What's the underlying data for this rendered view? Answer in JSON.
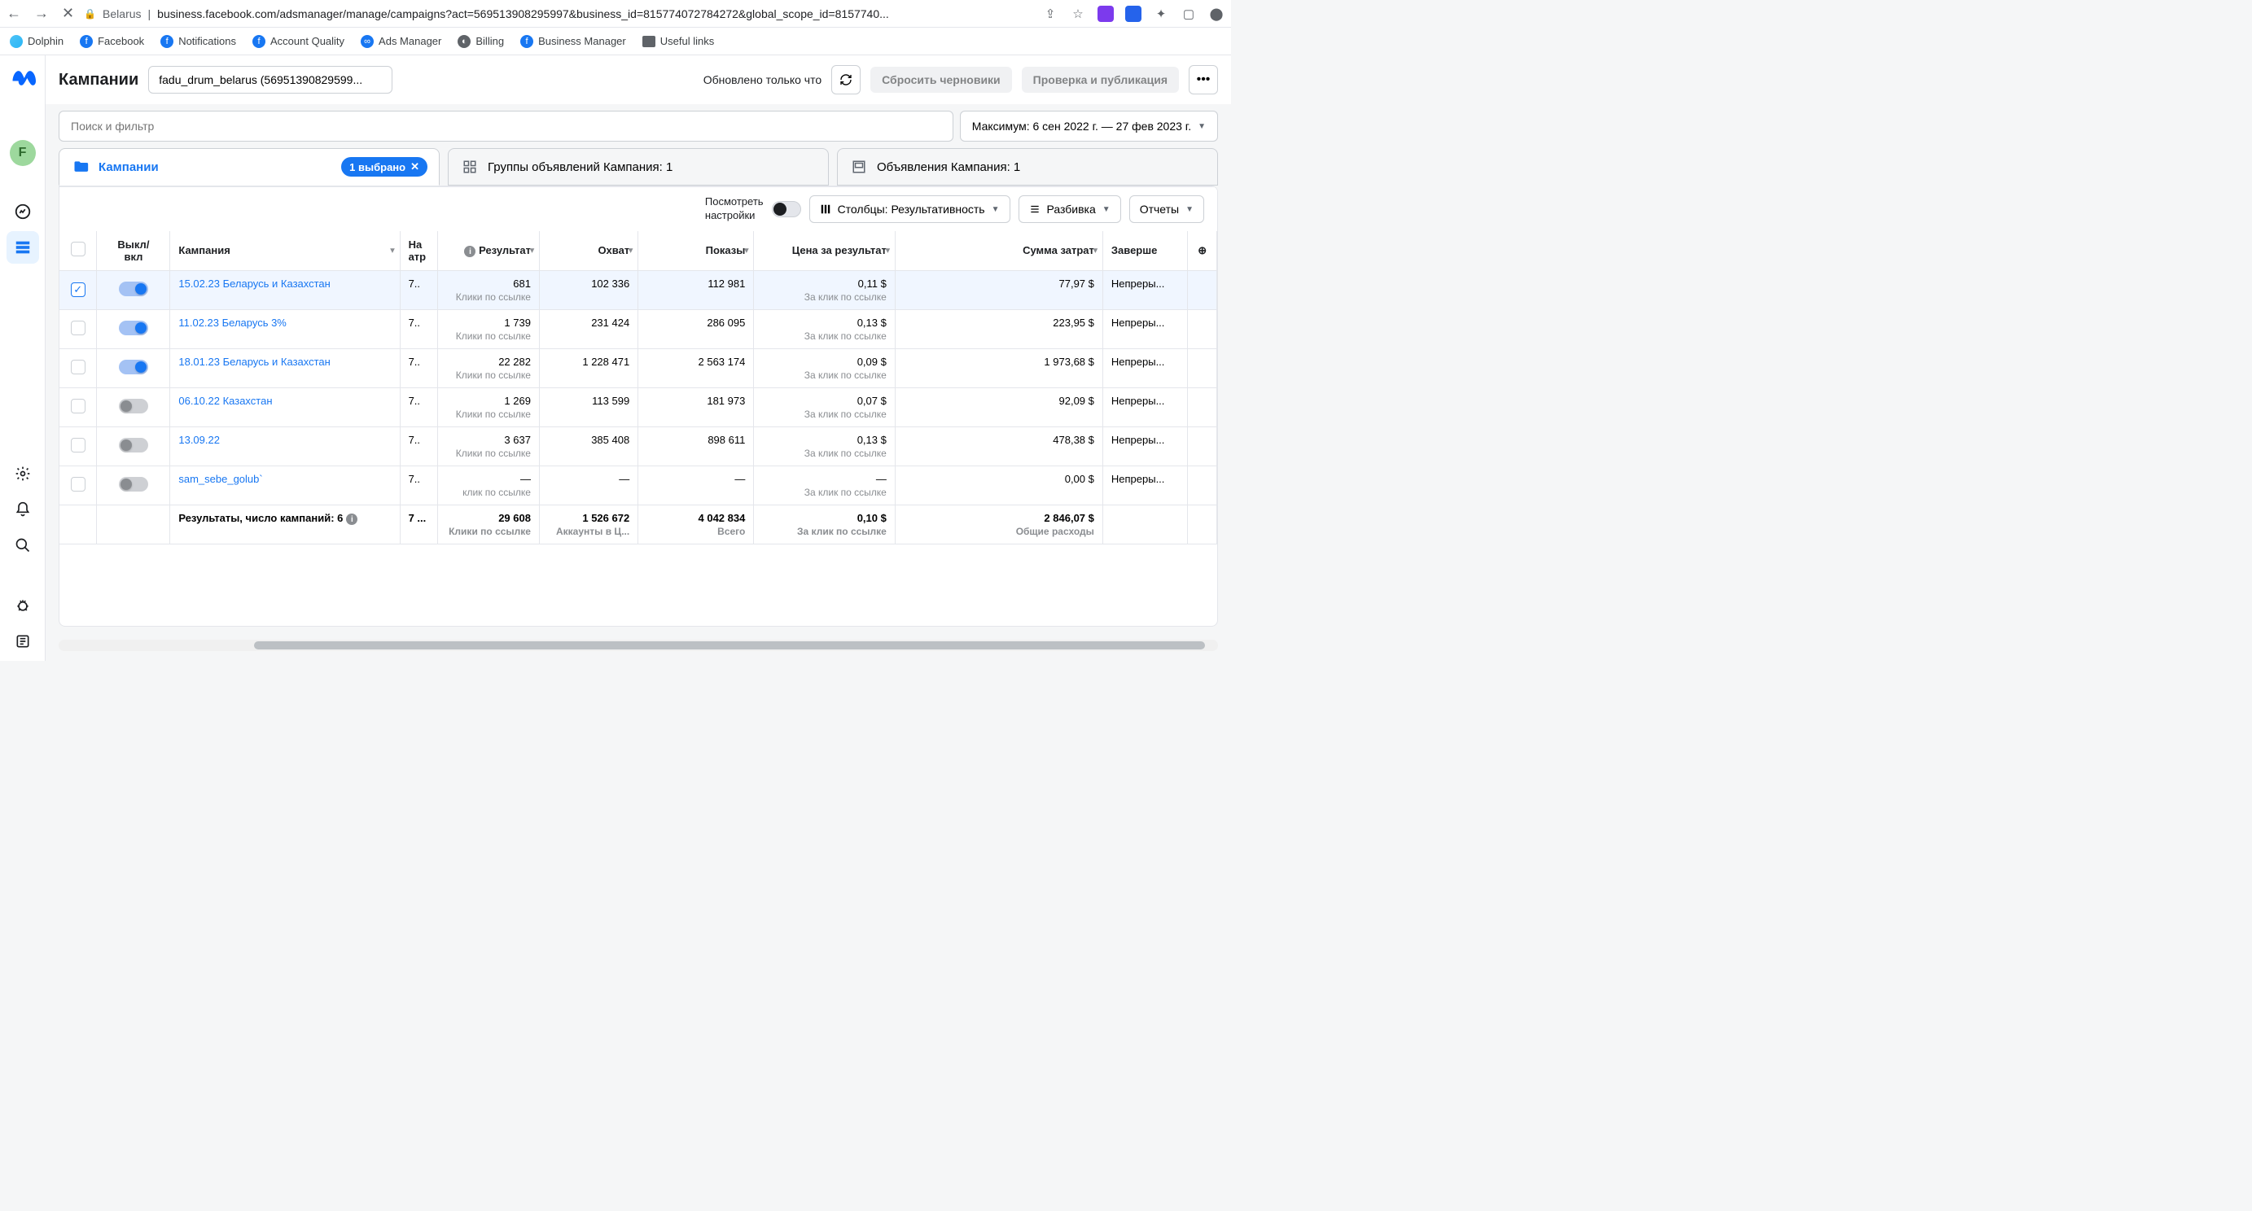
{
  "browser": {
    "country": "Belarus",
    "url": "business.facebook.com/adsmanager/manage/campaigns?act=569513908295997&business_id=815774072784272&global_scope_id=8157740..."
  },
  "bookmarks": [
    "Dolphin",
    "Facebook",
    "Notifications",
    "Account Quality",
    "Ads Manager",
    "Billing",
    "Business Manager",
    "Useful links"
  ],
  "header": {
    "title": "Кампании",
    "account": "fadu_drum_belarus (56951390829599...",
    "updated": "Обновлено только что",
    "reset": "Сбросить черновики",
    "review": "Проверка и публикация"
  },
  "search": {
    "placeholder": "Поиск и фильтр"
  },
  "date": "Максимум: 6 сен 2022 г. — 27 фев 2023 г.",
  "tabs": {
    "campaigns": "Кампании",
    "selected": "1 выбрано",
    "adsets": "Группы объявлений Кампания: 1",
    "ads": "Объявления Кампания: 1"
  },
  "toolbar": {
    "view_settings_l1": "Посмотреть",
    "view_settings_l2": "настройки",
    "columns": "Столбцы: Результативность",
    "breakdown": "Разбивка",
    "reports": "Отчеты"
  },
  "columns": {
    "onoff_l1": "Выкл/",
    "onoff_l2": "вкл",
    "campaign": "Кампания",
    "attr_l1": "На",
    "attr_l2": "атр",
    "result": "Результат",
    "reach": "Охват",
    "impressions": "Показы",
    "cpr": "Цена за результат",
    "spend": "Сумма затрат",
    "end": "Заверше"
  },
  "sublabels": {
    "link_clicks": "Клики по ссылке",
    "per_link_click": "За клик по ссылке",
    "click_link": "клик по ссылке",
    "accounts": "Аккаунты в Ц...",
    "total": "Всего",
    "total_spend": "Общие расходы"
  },
  "rows": [
    {
      "checked": true,
      "on": true,
      "name": "15.02.23 Беларусь и Казахстан",
      "attr": "7..",
      "result": "681",
      "reach": "102 336",
      "impr": "112 981",
      "cpr": "0,11 $",
      "spend": "77,97 $",
      "end": "Непреры..."
    },
    {
      "checked": false,
      "on": true,
      "name": "11.02.23 Беларусь 3%",
      "attr": "7..",
      "result": "1 739",
      "reach": "231 424",
      "impr": "286 095",
      "cpr": "0,13 $",
      "spend": "223,95 $",
      "end": "Непреры..."
    },
    {
      "checked": false,
      "on": true,
      "name": "18.01.23 Беларусь и Казахстан",
      "attr": "7..",
      "result": "22 282",
      "reach": "1 228 471",
      "impr": "2 563 174",
      "cpr": "0,09 $",
      "spend": "1 973,68 $",
      "end": "Непреры..."
    },
    {
      "checked": false,
      "on": false,
      "name": "06.10.22 Казахстан",
      "attr": "7..",
      "result": "1 269",
      "reach": "113 599",
      "impr": "181 973",
      "cpr": "0,07 $",
      "spend": "92,09 $",
      "end": "Непреры..."
    },
    {
      "checked": false,
      "on": false,
      "name": "13.09.22",
      "attr": "7..",
      "result": "3 637",
      "reach": "385 408",
      "impr": "898 611",
      "cpr": "0,13 $",
      "spend": "478,38 $",
      "end": "Непреры..."
    },
    {
      "checked": false,
      "on": false,
      "name": "sam_sebe_golub`",
      "attr": "7..",
      "result": "—",
      "reach": "—",
      "impr": "—",
      "cpr": "—",
      "spend": "0,00 $",
      "end": "Непреры..."
    }
  ],
  "totals": {
    "label": "Результаты, число кампаний: 6",
    "attr": "7 ...",
    "result": "29 608",
    "reach": "1 526 672",
    "impr": "4 042 834",
    "cpr": "0,10 $",
    "spend": "2 846,07 $"
  },
  "avatar": "F"
}
